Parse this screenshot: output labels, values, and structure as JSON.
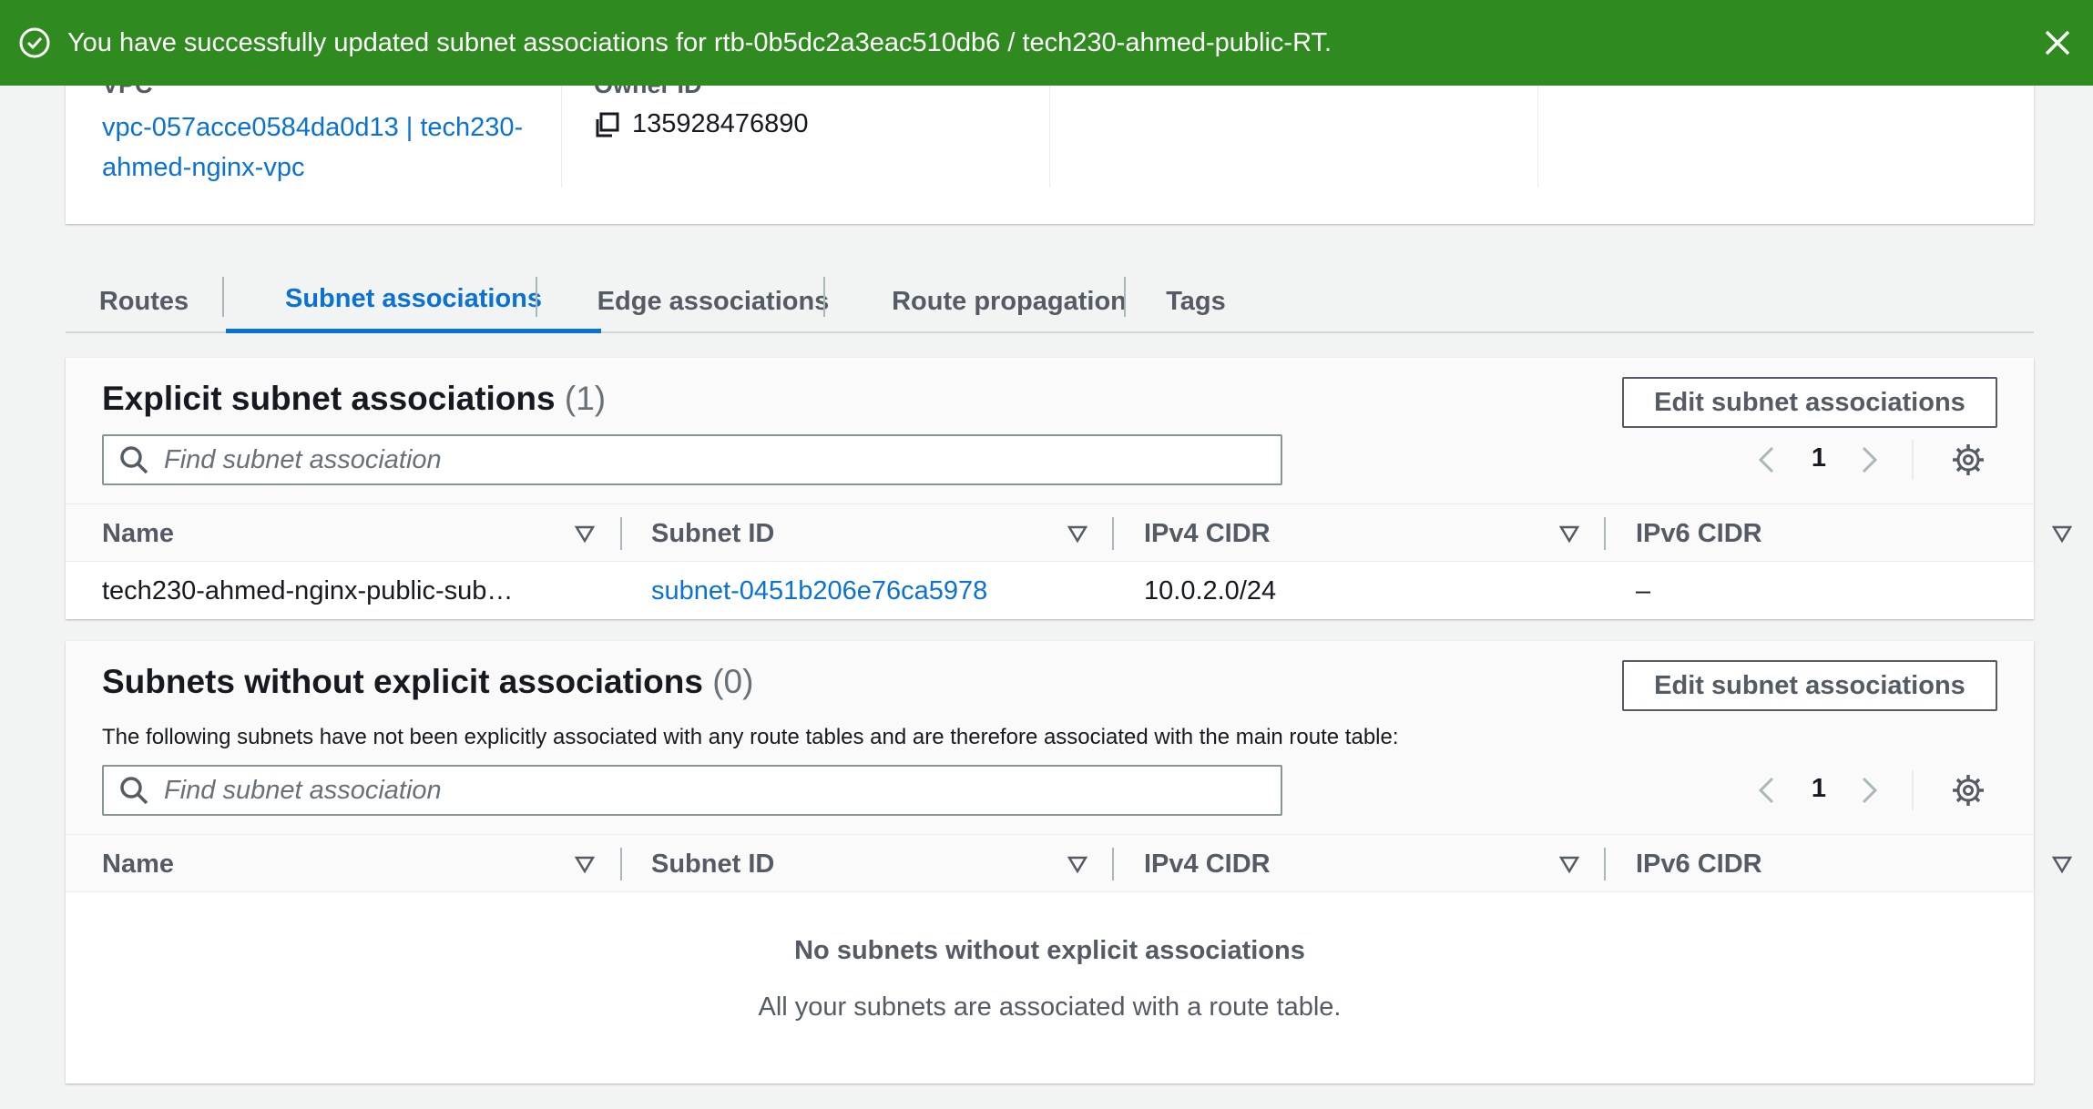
{
  "flash": {
    "message": "You have successfully updated subnet associations for rtb-0b5dc2a3eac510db6 / tech230-ahmed-public-RT.",
    "color": "#2f8a1f"
  },
  "details": {
    "vpc_label": "VPC",
    "vpc_value": "vpc-057acce0584da0d13 | tech230-ahmed-nginx-vpc",
    "owner_label": "Owner ID",
    "owner_value": "135928476890"
  },
  "tabs": [
    {
      "label": "Routes",
      "active": false
    },
    {
      "label": "Subnet associations",
      "active": true
    },
    {
      "label": "Edge associations",
      "active": false
    },
    {
      "label": "Route propagation",
      "active": false
    },
    {
      "label": "Tags",
      "active": false
    }
  ],
  "explicit": {
    "title": "Explicit subnet associations",
    "count": "(1)",
    "edit_label": "Edit subnet associations",
    "search_placeholder": "Find subnet association",
    "page": "1",
    "columns": [
      "Name",
      "Subnet ID",
      "IPv4 CIDR",
      "IPv6 CIDR"
    ],
    "rows": [
      {
        "name": "tech230-ahmed-nginx-public-sub…",
        "subnet_id": "subnet-0451b206e76ca5978",
        "ipv4": "10.0.2.0/24",
        "ipv6": "–"
      }
    ]
  },
  "implicit": {
    "title": "Subnets without explicit associations",
    "count": "(0)",
    "description": "The following subnets have not been explicitly associated with any route tables and are therefore associated with the main route table:",
    "edit_label": "Edit subnet associations",
    "search_placeholder": "Find subnet association",
    "page": "1",
    "columns": [
      "Name",
      "Subnet ID",
      "IPv4 CIDR",
      "IPv6 CIDR"
    ],
    "empty_title": "No subnets without explicit associations",
    "empty_sub": "All your subnets are associated with a route table."
  },
  "colors": {
    "link": "#0972d3",
    "success": "#2f8a1f"
  }
}
